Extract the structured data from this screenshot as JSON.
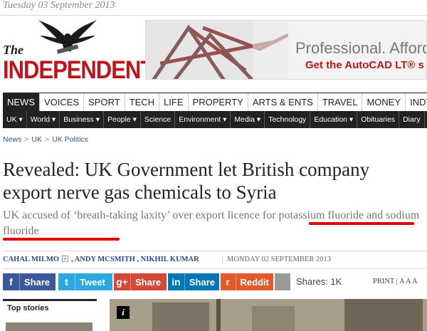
{
  "header": {
    "date": "Tuesday 03 September 2013",
    "logo_the": "The",
    "logo_name": "INDEPENDENT"
  },
  "ad": {
    "headline": "Professional. Afford",
    "subline": "Get the AutoCAD LT® s"
  },
  "nav": {
    "main": [
      "NEWS",
      "VOICES",
      "SPORT",
      "TECH",
      "LIFE",
      "PROPERTY",
      "ARTS & ENTS",
      "TRAVEL",
      "MONEY",
      "INDYBI"
    ],
    "active": "NEWS",
    "sub": [
      "UK ▾",
      "World ▾",
      "Business ▾",
      "People ▾",
      "Science",
      "Environment ▾",
      "Media ▾",
      "Technology",
      "Education ▾",
      "Obituaries",
      "Diary"
    ]
  },
  "breadcrumb": [
    "News",
    "UK",
    "UK Politics"
  ],
  "article": {
    "headline": "Revealed: UK Government let British company export nerve gas chemicals to Syria",
    "standfirst": "UK accused of ‘breath-taking laxity’ over export licence for potassium fluoride and sodium fluoride",
    "authors": [
      "CAHAL MILMO",
      "ANDY MCSMITH",
      "NIKHIL KUMAR"
    ],
    "date": "MONDAY 02 SEPTEMBER 2013"
  },
  "share": {
    "buttons": [
      {
        "icon": "f",
        "label": "Share",
        "color": "#3b5998"
      },
      {
        "icon": "t",
        "label": "Tweet",
        "color": "#2aa9e0"
      },
      {
        "icon": "g+",
        "label": "Share",
        "color": "#d34836"
      },
      {
        "icon": "in",
        "label": "Share",
        "color": "#0077b5"
      },
      {
        "icon": "r",
        "label": "Reddit",
        "color": "#e05a2b"
      }
    ],
    "shares_label": "Shares: 1K",
    "print_label": "PRINT",
    "text_size_label": "A A A"
  },
  "sidebar": {
    "top_stories_label": "Top stories"
  },
  "colors": {
    "brand_red": "#c0141b",
    "highlight_underline": "#e10000",
    "link_blue": "#2a5a9a"
  }
}
